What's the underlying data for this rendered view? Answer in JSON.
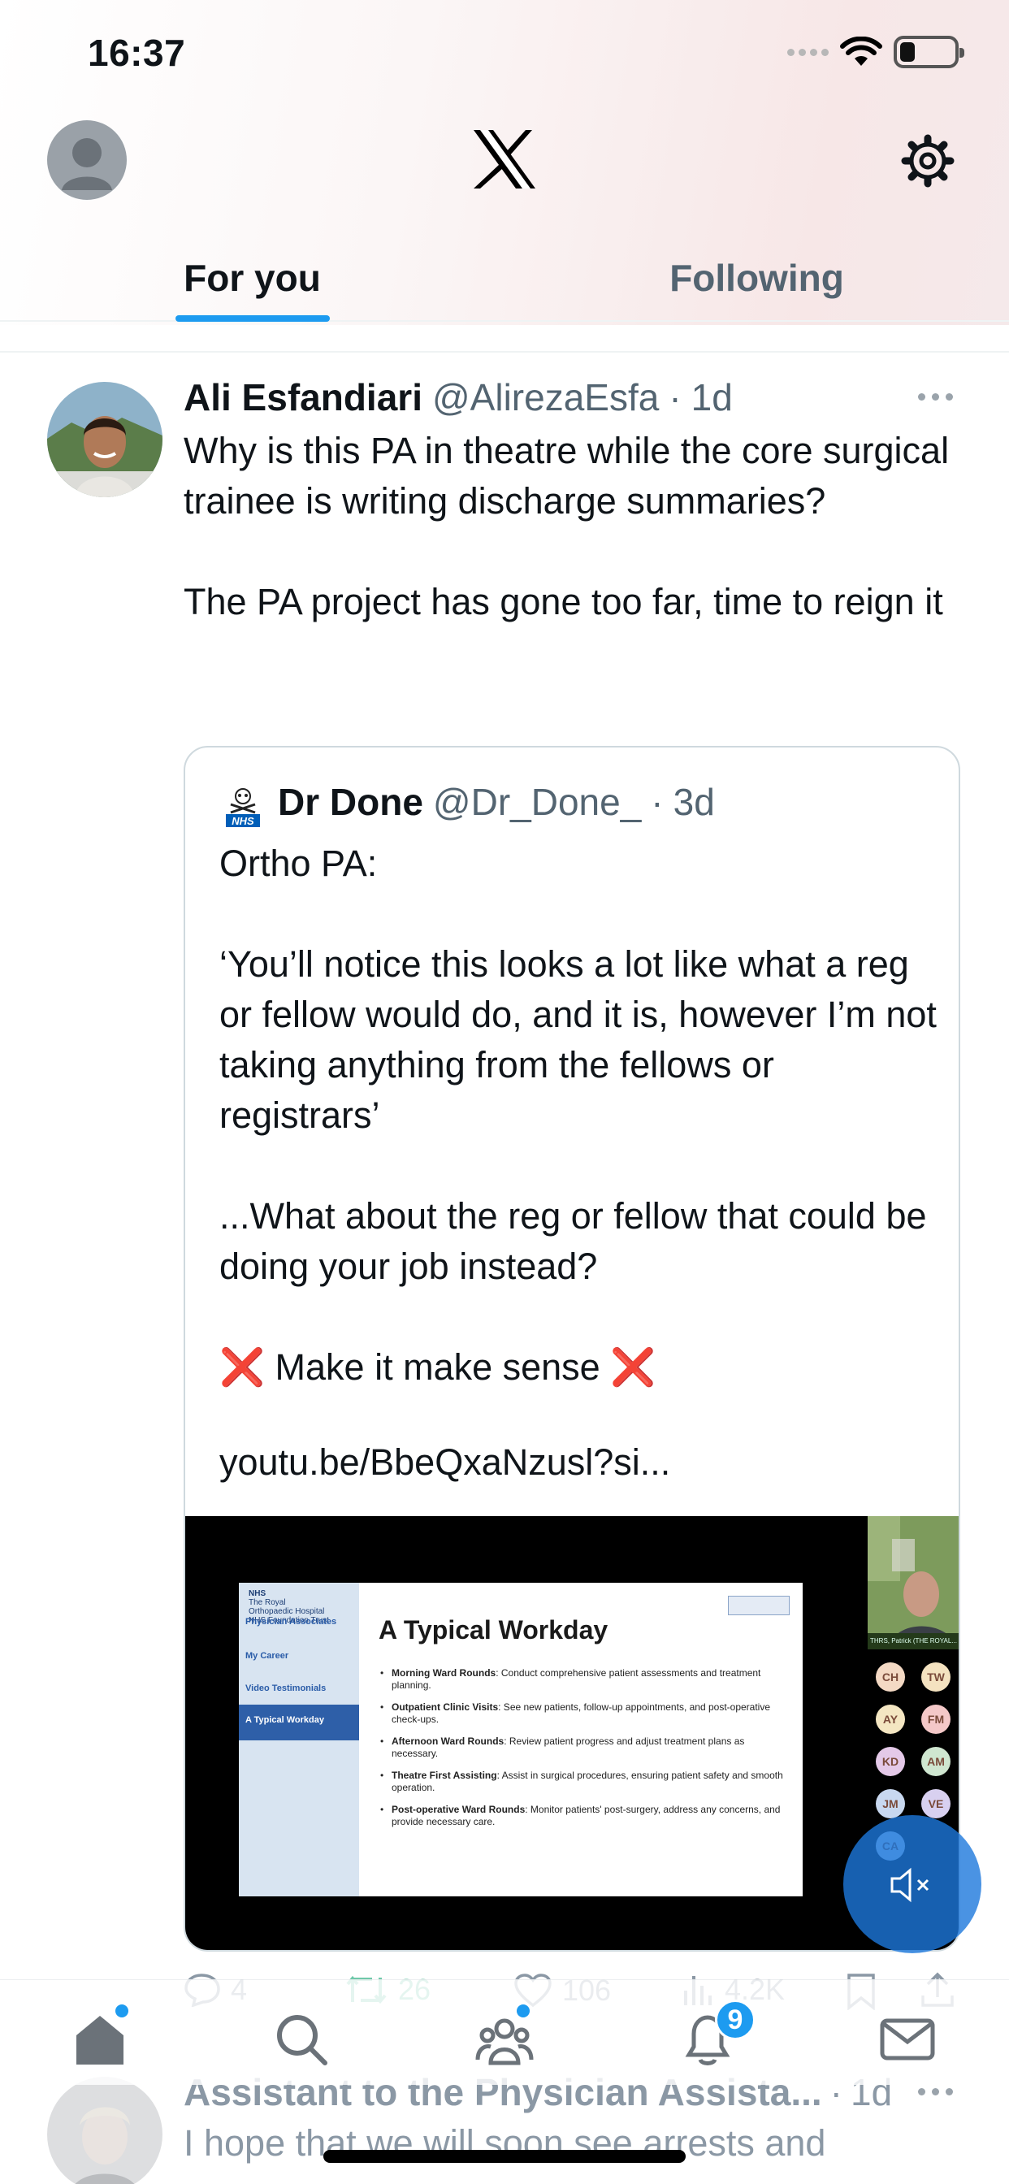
{
  "status_bar": {
    "time": "16:37"
  },
  "header": {
    "logo": "x-logo",
    "settings_icon": "gear-icon",
    "tabs": [
      {
        "label": "For you",
        "active": true
      },
      {
        "label": "Following",
        "active": false
      }
    ]
  },
  "tweet": {
    "author_name": "Ali Esfandiari",
    "author_handle": "@AlirezaEsfa",
    "dot": "·",
    "age": "1d",
    "text": "Why is this PA in theatre while the core surgical trainee is writing discharge summaries?\n\nThe PA project has gone too far, time to reign it",
    "quote": {
      "author_name": "Dr Done",
      "author_handle": "@Dr_Done_",
      "dot": "·",
      "age": "3d",
      "text": "Ortho PA:\n\n‘You’ll notice this looks a lot like what a reg or fellow would do, and it is, however I’m not taking anything from the fellows or registrars’\n\n...What about the reg or fellow that could be doing your job instead?\n\n",
      "emphasis_line": "Make it make sense",
      "emphasis_icon": "❌",
      "link": "youtu.be/BbeQxaNzusl?si...",
      "video": {
        "slide_header": [
          "NHS",
          "The Royal",
          "Orthopaedic Hospital",
          "NHS Foundation Trust"
        ],
        "slide_nav": [
          "Physician Associates",
          "My Career",
          "Video Testimonials",
          "A Typical Workday"
        ],
        "slide_title": "A Typical Workday",
        "slide_items": [
          {
            "bold": "Morning Ward Rounds",
            "text": ": Conduct comprehensive patient assessments and treatment planning."
          },
          {
            "bold": "Outpatient Clinic Visits",
            "text": ": See new patients, follow-up appointments, and post-operative check-ups."
          },
          {
            "bold": "Afternoon Ward Rounds",
            "text": ": Review patient progress and adjust treatment plans as necessary."
          },
          {
            "bold": "Theatre First Assisting",
            "text": ": Assist in surgical procedures, ensuring patient safety and smooth operation."
          },
          {
            "bold": "Post-operative Ward Rounds",
            "text": ": Monitor patients' post-surgery, address any concerns, and provide necessary care."
          }
        ],
        "camera_label": "THRS, Patrick (THE ROYAL...",
        "participants": [
          "CH",
          "TW",
          "AY",
          "FM",
          "KD",
          "AM",
          "JM",
          "VE",
          "CA"
        ],
        "participant_colors": [
          "#f4d9c4",
          "#f4e2c0",
          "#f4e6c2",
          "#f4c8c8",
          "#e4c9e8",
          "#cfe6d0",
          "#c8d8f0",
          "#d8d0f0",
          "#c8dcf0"
        ]
      }
    },
    "actions": {
      "replies": "4",
      "reposts": "26",
      "likes": "106",
      "views": "4.2K"
    }
  },
  "bottom_nav": {
    "items": [
      "home-icon",
      "search-icon",
      "communities-icon",
      "notifications-icon",
      "messages-icon"
    ],
    "notification_count": "9"
  },
  "next_tweet": {
    "author_name": "Assistant to the Physician Assista...",
    "dot": "·",
    "age": "1d",
    "text": "I hope that we will soon see arrests and"
  },
  "colors": {
    "accent": "#1d9bf0",
    "text": "#0f1419",
    "secondary": "#536471",
    "repost": "#00ba7c",
    "cross": "#d8202a"
  }
}
